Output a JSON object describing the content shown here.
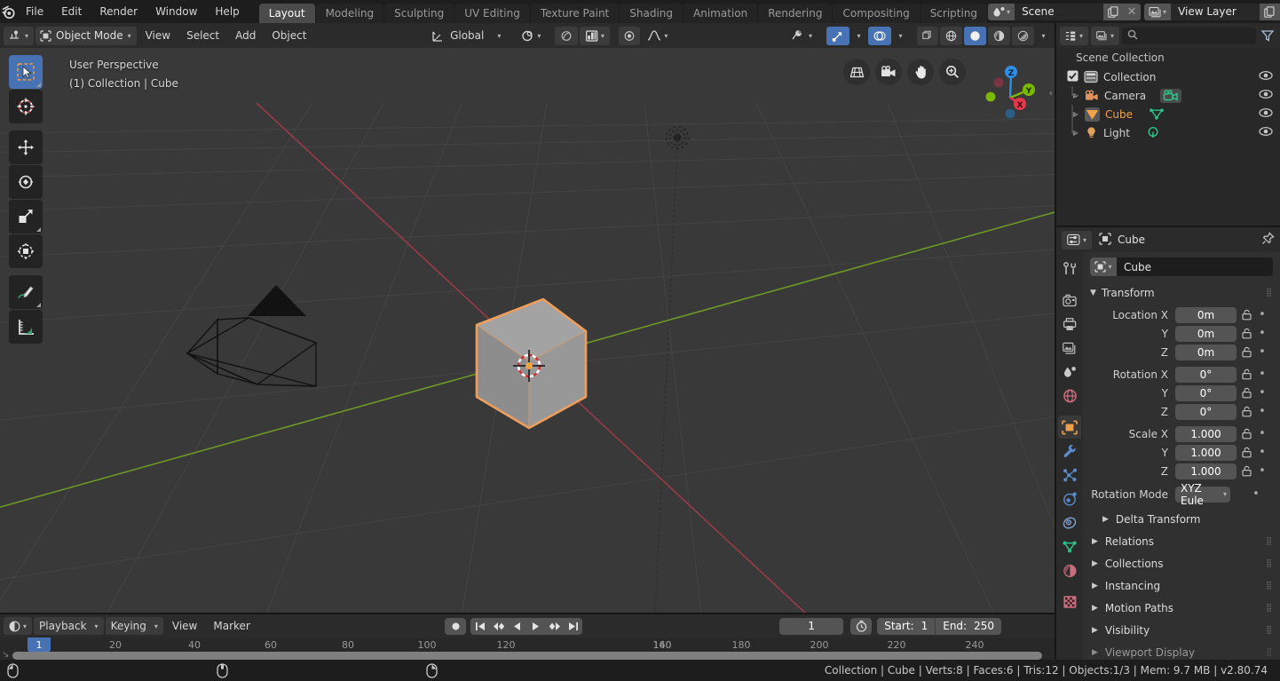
{
  "topbar": {
    "logo": "blender-logo",
    "menus": [
      "File",
      "Edit",
      "Render",
      "Window",
      "Help"
    ],
    "workspaces": [
      {
        "label": "Layout",
        "active": true
      },
      {
        "label": "Modeling",
        "active": false
      },
      {
        "label": "Sculpting",
        "active": false
      },
      {
        "label": "UV Editing",
        "active": false
      },
      {
        "label": "Texture Paint",
        "active": false
      },
      {
        "label": "Shading",
        "active": false
      },
      {
        "label": "Animation",
        "active": false
      },
      {
        "label": "Rendering",
        "active": false
      },
      {
        "label": "Compositing",
        "active": false
      },
      {
        "label": "Scripting",
        "active": false
      }
    ],
    "scene_name": "Scene",
    "viewlayer_name": "View Layer"
  },
  "viewheader": {
    "editor_icon": "editor-type-icon",
    "mode": "Object Mode",
    "menus": [
      "View",
      "Select",
      "Add",
      "Object"
    ],
    "transform_orientation": "Global",
    "snap_icon": "magnet-icon",
    "proportional_icon": "proportional-edit-icon",
    "falloff_icon": "falloff-curve-icon",
    "visibility_icon": "visibility-eye-icon",
    "gizmo_icon": "gizmo-icon",
    "overlays_icon": "overlays-icon",
    "xray_icon": "xray-icon",
    "shading_modes": [
      "wireframe",
      "solid",
      "material",
      "rendered"
    ],
    "shading_active": "solid"
  },
  "viewport": {
    "perspective_label": "User Perspective",
    "collection_label": "(1) Collection | Cube",
    "tools": [
      {
        "name": "select-box-tool",
        "active": true
      },
      {
        "name": "cursor-tool",
        "active": false
      },
      {
        "name": "move-tool",
        "active": false
      },
      {
        "name": "rotate-tool",
        "active": false
      },
      {
        "name": "scale-tool",
        "active": false
      },
      {
        "name": "transform-tool",
        "active": false
      },
      {
        "name": "annotate-tool",
        "active": false
      },
      {
        "name": "measure-tool",
        "active": false
      }
    ],
    "nav_icons": [
      "grid-icon",
      "camera-icon",
      "hand-icon",
      "zoom-icon"
    ],
    "gizmo_axes": [
      {
        "label": "Z",
        "color": "#2f8fe8"
      },
      {
        "label": "Y",
        "color": "#7bb900"
      },
      {
        "label": "X",
        "color": "#e8374b"
      }
    ],
    "objects": [
      "Camera",
      "Cube",
      "Light"
    ],
    "selected_object": "Cube",
    "selection_color": "#ed9e5c",
    "grid_color": "#4b4b4b",
    "axis_x_color": "#a43b48",
    "axis_y_color": "#7aa32a",
    "background_color": "#393939"
  },
  "outliner": {
    "header": {
      "display_mode_icon": "outliner-display-mode-icon",
      "filter_id_icon": "filter-id-icon",
      "search_placeholder": "",
      "search_icon": "search-icon",
      "filter_icon": "filter-funnel-icon"
    },
    "title": "Scene Collection",
    "rows": [
      {
        "label": "Collection",
        "icon": "collection-icon",
        "indent": 0,
        "checkbox": true,
        "selected": false,
        "expand": false,
        "datatype": null
      },
      {
        "label": "Camera",
        "icon": "camera-data-icon",
        "indent": 1,
        "checkbox": false,
        "selected": false,
        "expand": true,
        "datatype": "camera-data-green-icon"
      },
      {
        "label": "Cube",
        "icon": "mesh-object-icon",
        "indent": 1,
        "checkbox": false,
        "selected": true,
        "expand": true,
        "datatype": "mesh-data-green-icon"
      },
      {
        "label": "Light",
        "icon": "light-object-icon",
        "indent": 1,
        "checkbox": false,
        "selected": false,
        "expand": true,
        "datatype": "light-data-green-icon"
      }
    ],
    "eye_icon": "eye-icon"
  },
  "properties": {
    "header": {
      "editor_icon": "properties-editor-icon",
      "breadcrumb_icon": "object-icon",
      "breadcrumb": "Cube",
      "pin_icon": "pin-icon"
    },
    "tabs": [
      {
        "name": "tool-tab",
        "active": false
      },
      {
        "name": "render-tab",
        "active": false
      },
      {
        "name": "output-tab",
        "active": false
      },
      {
        "name": "view-layer-tab",
        "active": false
      },
      {
        "name": "scene-tab",
        "active": false
      },
      {
        "name": "world-tab",
        "active": false
      },
      {
        "name": "object-tab",
        "active": true
      },
      {
        "name": "modifier-tab",
        "active": false
      },
      {
        "name": "particles-tab",
        "active": false
      },
      {
        "name": "physics-tab",
        "active": false
      },
      {
        "name": "constraints-tab",
        "active": false
      },
      {
        "name": "object-data-tab",
        "active": false
      },
      {
        "name": "material-tab",
        "active": false
      },
      {
        "name": "texture-tab",
        "active": false
      }
    ],
    "object_name": "Cube",
    "transform_panel": {
      "title": "Transform",
      "fields": [
        {
          "label": "Location X",
          "value": "0m"
        },
        {
          "label": "Y",
          "value": "0m"
        },
        {
          "label": "Z",
          "value": "0m"
        },
        {
          "label": "Rotation X",
          "value": "0°"
        },
        {
          "label": "Y",
          "value": "0°"
        },
        {
          "label": "Z",
          "value": "0°"
        },
        {
          "label": "Scale X",
          "value": "1.000"
        },
        {
          "label": "Y",
          "value": "1.000"
        },
        {
          "label": "Z",
          "value": "1.000"
        }
      ],
      "rotation_mode_label": "Rotation Mode",
      "rotation_mode_value": "XYZ Eule",
      "delta_transform": "Delta Transform"
    },
    "panels": [
      "Relations",
      "Collections",
      "Instancing",
      "Motion Paths",
      "Visibility",
      "Viewport Display"
    ]
  },
  "timeline": {
    "editor_icon": "timeline-editor-icon",
    "menus": [
      "Playback",
      "Keying",
      "View",
      "Marker"
    ],
    "playback_buttons": [
      "record-icon",
      "jump-start-icon",
      "prev-keyframe-icon",
      "play-reverse-icon",
      "play-icon",
      "next-keyframe-icon",
      "jump-end-icon"
    ],
    "current_frame": "1",
    "auto_key_icon": "auto-keying-icon",
    "start_label": "Start:",
    "start_value": "1",
    "end_label": "End:",
    "end_value": "250",
    "ticks": [
      20,
      40,
      60,
      80,
      100,
      120,
      140,
      160,
      180,
      200,
      220,
      240
    ],
    "playhead_frame": "1"
  },
  "statusbar": {
    "mouse_hints": [
      "select-mouse-icon",
      "pan-mouse-icon",
      "zoom-mouse-icon"
    ],
    "info": "Collection | Cube | Verts:8 | Faces:6 | Tris:12 | Objects:1/3 | Mem: 9.7 MB | v2.80.74"
  }
}
